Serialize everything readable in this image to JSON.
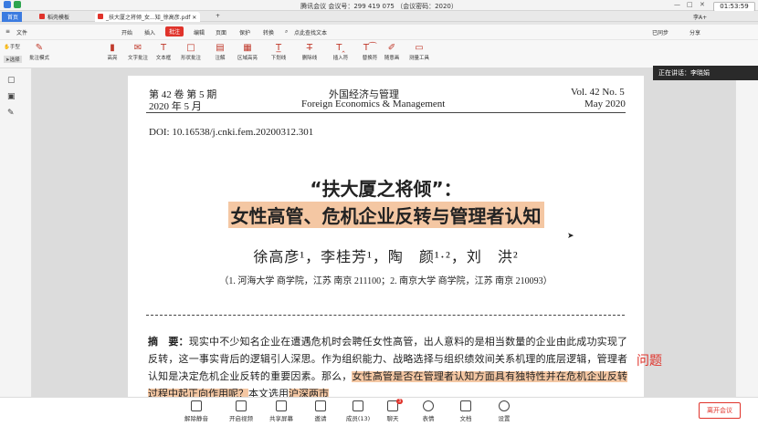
{
  "meeting": {
    "title": "腾讯会议 会议号：299 419 075 （会议密码：2020）",
    "clock": "01:53:59",
    "user": "李A+"
  },
  "tabs": [
    {
      "label": "首页",
      "color": "#3b7be0"
    },
    {
      "label": "稻壳模板",
      "color": "#e0332b"
    },
    {
      "label": "_扶大厦之将倾_女...知_徐高彦.pdf",
      "color": "#e0332b"
    }
  ],
  "menus": [
    "文件",
    "开始",
    "插入",
    "批注",
    "编辑",
    "页面",
    "保护",
    "转换"
  ],
  "menu_search": "点此查找文本",
  "sync": [
    "已同步",
    "分享"
  ],
  "tools": [
    "批注模式",
    "高亮",
    "文字批注",
    "文本框",
    "形状批注",
    "注解",
    "区域高亮",
    "下划线",
    "删除线",
    "插入符",
    "替换符",
    "随意画",
    "测量工具"
  ],
  "left_tools": [
    "手型",
    "选择"
  ],
  "page": {
    "vol_cn": "第 42 卷 第 5 期",
    "date_cn": "2020 年 5 月",
    "journal_cn": "外国经济与管理",
    "journal_en": "Foreign Economics & Management",
    "vol_en": "Vol. 42 No. 5",
    "date_en": "May  2020",
    "doi": "DOI: 10.16538/j.cnki.fem.20200312.301",
    "title1": "“扶大厦之将倾”：",
    "title2": "女性高管、危机企业反转与管理者认知",
    "authors": "徐高彦¹，李桂芳¹，陶　颜¹·²，刘　洪²",
    "affiliation": "（1. 河海大学 商学院，江苏 南京 211100；2. 南京大学 商学院，江苏 南京 210093）",
    "abstract_label": "摘　要：",
    "abstract_a": "现实中不少知名企业在遭遇危机时会聘任女性高管，出人意料的是相当数量的企业由此成功实现了反转，这一事实背后的逻辑引人深思。作为组织能力、战略选择与组织绩效间关系机理的底层逻辑，管理者认知是决定危机企业反转的重要因素。那么，",
    "abstract_hl": "女性高管是否在管理者认知方面具有独特性并在危机企业反转过程中起正向作用呢？",
    "abstract_b": "本文选用",
    "abstract_hl2": "沪深两市"
  },
  "annotation": "问题",
  "speaker": "正在讲话：李晓娟",
  "bottom": [
    {
      "label": "解除静音"
    },
    {
      "label": "开启视频"
    },
    {
      "label": "共享屏幕"
    },
    {
      "label": "邀请"
    },
    {
      "label": "成员(13)"
    },
    {
      "label": "聊天",
      "badge": "3"
    },
    {
      "label": "表情"
    },
    {
      "label": "文档"
    },
    {
      "label": "设置"
    }
  ],
  "leave": "离开会议"
}
